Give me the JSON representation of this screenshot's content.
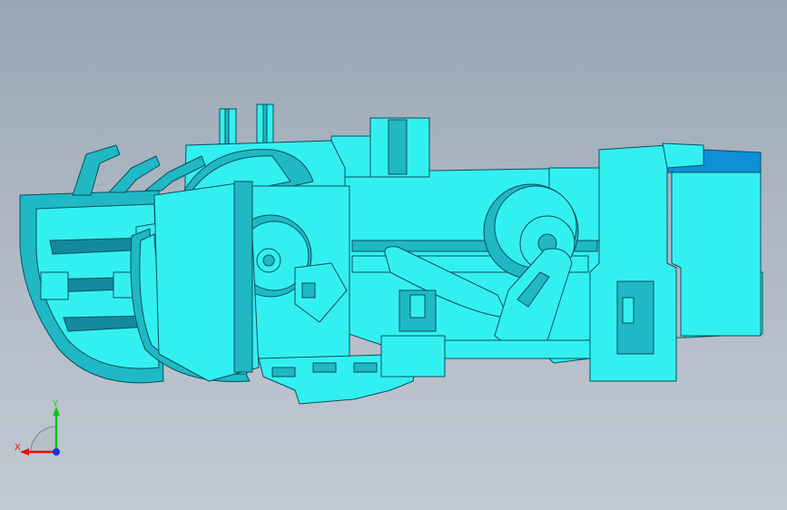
{
  "viewport": {
    "model_color": "#33f0f0",
    "model_shade": "#1fb8c4",
    "model_dark": "#128a9c",
    "edge_color": "#0a4f5e",
    "end_cap_color": "#0e8fd6"
  },
  "triad": {
    "x_label": "X",
    "y_label": "Y",
    "x_color": "#e01010",
    "y_color": "#18c018",
    "z_color": "#1830e0"
  }
}
